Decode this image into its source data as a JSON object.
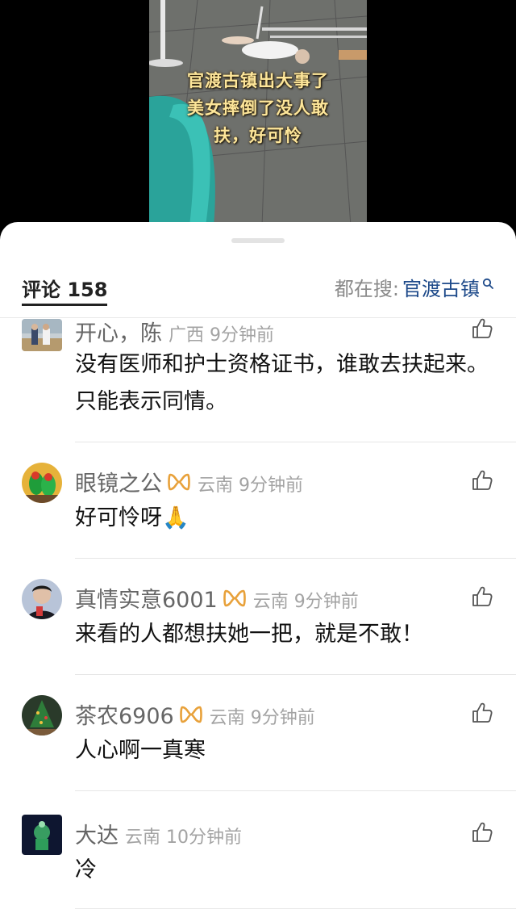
{
  "video": {
    "caption_lines": [
      "官渡古镇出大事了",
      "美女摔倒了没人敢",
      "扶，好可怜"
    ]
  },
  "header": {
    "comment_count_label": "评论 158",
    "search_prefix": "都在搜:",
    "search_term": "官渡古镇",
    "search_icon": "search-icon"
  },
  "comments": [
    {
      "username": "开心，陈",
      "location_time": "广西 9分钟前",
      "text": "没有医师和护士资格证书，谁敢去扶起来。只能表示同情。",
      "badge": false
    },
    {
      "username": "眼镜之公",
      "location_time": "云南 9分钟前",
      "text": "好可怜呀🙏",
      "badge": true
    },
    {
      "username": "真情实意6001",
      "location_time": "云南 9分钟前",
      "text": "来看的人都想扶她一把，就是不敢！",
      "badge": true
    },
    {
      "username": "茶农6906",
      "location_time": "云南 9分钟前",
      "text": "人心啊一真寒",
      "badge": true
    },
    {
      "username": "大达",
      "location_time": "云南 10分钟前",
      "text": "冷",
      "badge": false
    }
  ],
  "colors": {
    "badge_gold": "#e8a13a",
    "link_blue": "#1e4a8a"
  }
}
